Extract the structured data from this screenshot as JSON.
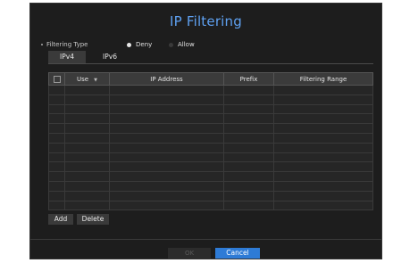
{
  "dialog": {
    "title": "IP Filtering",
    "filtering_type_label": "Filtering Type",
    "options": [
      {
        "label": "Deny",
        "selected": true
      },
      {
        "label": "Allow",
        "selected": false
      }
    ],
    "tabs": [
      {
        "label": "IPv4",
        "active": true
      },
      {
        "label": "IPv6",
        "active": false
      }
    ],
    "table": {
      "columns": [
        "",
        "Use",
        "IP Address",
        "Prefix",
        "Filtering Range"
      ],
      "rows": [
        [
          "",
          "",
          "",
          "",
          ""
        ],
        [
          "",
          "",
          "",
          "",
          ""
        ],
        [
          "",
          "",
          "",
          "",
          ""
        ],
        [
          "",
          "",
          "",
          "",
          ""
        ],
        [
          "",
          "",
          "",
          "",
          ""
        ],
        [
          "",
          "",
          "",
          "",
          ""
        ],
        [
          "",
          "",
          "",
          "",
          ""
        ],
        [
          "",
          "",
          "",
          "",
          ""
        ],
        [
          "",
          "",
          "",
          "",
          ""
        ],
        [
          "",
          "",
          "",
          "",
          ""
        ],
        [
          "",
          "",
          "",
          "",
          ""
        ],
        [
          "",
          "",
          "",
          "",
          ""
        ],
        [
          "",
          "",
          "",
          "",
          ""
        ]
      ]
    },
    "buttons": {
      "add": "Add",
      "delete": "Delete",
      "ok": "OK",
      "cancel": "Cancel"
    },
    "colors": {
      "background": "#1d1d1d",
      "title": "#5ea0f0",
      "accent": "#2e7bd6"
    }
  }
}
